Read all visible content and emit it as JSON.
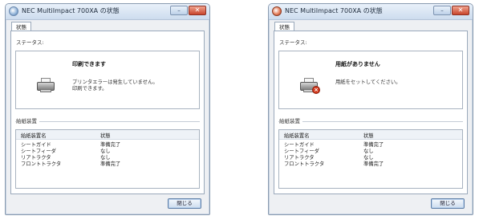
{
  "windows": [
    {
      "title": "NEC MultiImpact 700XA の状態",
      "tab": "状態",
      "status_label": "ステータス:",
      "status_title": "印刷できます",
      "status_message": [
        "プリンタエラーは発生していません。",
        "印刷できます。"
      ],
      "icon": "printer-icon",
      "feeder_label": "給紙装置",
      "table": {
        "headers": [
          "給紙装置名",
          "状態"
        ],
        "rows": [
          [
            "シートガイド",
            "準備完了"
          ],
          [
            "シートフィーダ",
            "なし"
          ],
          [
            "リアトラクタ",
            "なし"
          ],
          [
            "フロントトラクタ",
            "準備完了"
          ]
        ]
      },
      "close_label": "閉じる"
    },
    {
      "title": "NEC MultiImpact 700XA の状態",
      "tab": "状態",
      "status_label": "ステータス:",
      "status_title": "用紙がありません",
      "status_message": [
        "用紙をセットしてください。"
      ],
      "icon": "printer-error-icon",
      "feeder_label": "給紙装置",
      "table": {
        "headers": [
          "給紙装置名",
          "状態"
        ],
        "rows": [
          [
            "シートガイド",
            "準備完了"
          ],
          [
            "シートフィーダ",
            "なし"
          ],
          [
            "リアトラクタ",
            "なし"
          ],
          [
            "フロントトラクタ",
            "準備完了"
          ]
        ]
      },
      "close_label": "閉じる"
    }
  ]
}
